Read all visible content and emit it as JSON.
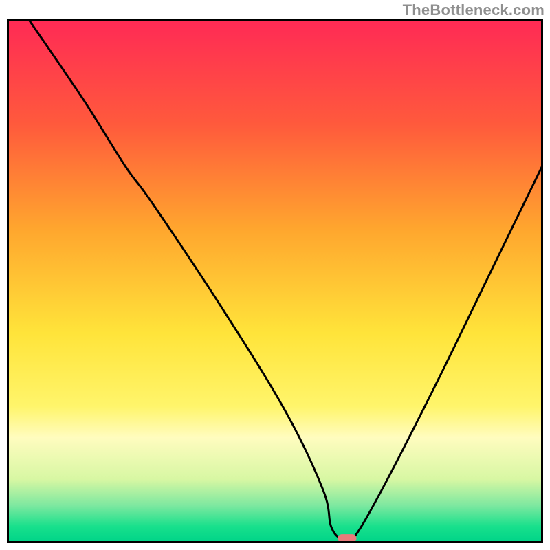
{
  "watermark": "TheBottleneck.com",
  "chart_data": {
    "type": "line",
    "title": "",
    "xlabel": "",
    "ylabel": "",
    "xlim": [
      0,
      100
    ],
    "ylim": [
      0,
      100
    ],
    "grid": false,
    "legend": false,
    "axes_visible": false,
    "background": {
      "type": "vertical-gradient",
      "stops": [
        {
          "at": 0,
          "color": "#ff2a55"
        },
        {
          "at": 20,
          "color": "#ff5a3c"
        },
        {
          "at": 40,
          "color": "#ffa62e"
        },
        {
          "at": 60,
          "color": "#ffe43a"
        },
        {
          "at": 74,
          "color": "#fff56b"
        },
        {
          "at": 80,
          "color": "#fffcbf"
        },
        {
          "at": 88,
          "color": "#d7f7a3"
        },
        {
          "at": 93,
          "color": "#7de8a0"
        },
        {
          "at": 97,
          "color": "#18e08c"
        },
        {
          "at": 100,
          "color": "#00d488"
        }
      ]
    },
    "series": [
      {
        "name": "curve",
        "color": "#000000",
        "stroke_width": 3,
        "x": [
          4,
          14,
          22,
          27,
          40,
          52,
          59,
          60.5,
          62.5,
          64.5,
          70,
          80,
          90,
          100
        ],
        "y": [
          100,
          85,
          72,
          65,
          45,
          25,
          10,
          3,
          0.5,
          0.5,
          10,
          30,
          51,
          72
        ]
      }
    ],
    "marker": {
      "name": "optimal-point",
      "x": 63.5,
      "y": 0.7,
      "width_pct": 3.5,
      "height_pct": 1.6,
      "color": "#e97b7b",
      "shape": "rounded-rect"
    },
    "frame": {
      "stroke": "#000000",
      "width": 3
    }
  }
}
